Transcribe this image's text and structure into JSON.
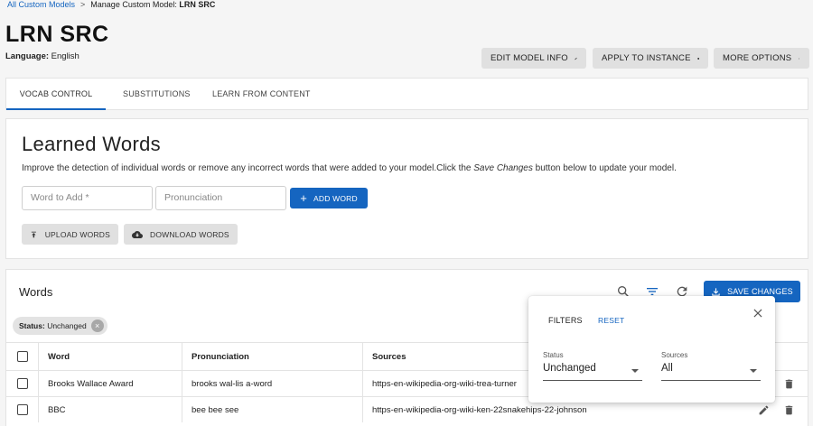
{
  "breadcrumb": {
    "root": "All Custom Models",
    "separator": ">",
    "current_prefix": "Manage Custom Model:",
    "current_model": "LRN SRC"
  },
  "header": {
    "title": "LRN SRC",
    "language_label": "Language:",
    "language_value": "English",
    "buttons": {
      "edit": "EDIT MODEL INFO",
      "apply": "APPLY TO INSTANCE",
      "more": "MORE OPTIONS"
    }
  },
  "tabs": [
    {
      "label": "VOCAB CONTROL",
      "active": true
    },
    {
      "label": "SUBSTITUTIONS",
      "active": false
    },
    {
      "label": "LEARN FROM CONTENT",
      "active": false
    }
  ],
  "learned": {
    "title": "Learned Words",
    "desc_before": "Improve the detection of individual words or remove any incorrect words that were added to your model.Click the ",
    "desc_em": "Save Changes",
    "desc_after": " button below to update your model.",
    "word_placeholder": "Word to Add *",
    "pron_placeholder": "Pronunciation",
    "add_label": "ADD WORD",
    "upload_label": "UPLOAD WORDS",
    "download_label": "DOWNLOAD WORDS"
  },
  "words": {
    "title": "Words",
    "save_label": "SAVE CHANGES",
    "chip_key": "Status:",
    "chip_value": "Unchanged",
    "columns": [
      "Word",
      "Pronunciation",
      "Sources"
    ],
    "rows": [
      {
        "word": "Brooks Wallace Award",
        "pron": "brooks wal-lis a-word",
        "src": "https-en-wikipedia-org-wiki-trea-turner"
      },
      {
        "word": "BBC",
        "pron": "bee bee see",
        "src": "https-en-wikipedia-org-wiki-ken-22snakehips-22-johnson"
      }
    ]
  },
  "filters": {
    "title": "FILTERS",
    "reset": "RESET",
    "status_label": "Status",
    "status_value": "Unchanged",
    "sources_label": "Sources",
    "sources_value": "All"
  },
  "colors": {
    "accent": "#1565c0",
    "button_grey": "#e0e0e0"
  }
}
